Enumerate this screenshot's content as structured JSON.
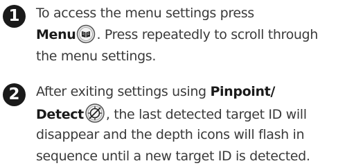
{
  "steps": [
    {
      "number": "1",
      "line1": "To access the menu settings press",
      "line2_bold": "Menu",
      "line2_rest": ". Press repeatedly to scroll through",
      "line3": "the menu settings.",
      "icon": "menu-book-icon"
    },
    {
      "number": "2",
      "line1_pre": "After exiting settings using ",
      "line1_bold": "Pinpoint/",
      "line2_bold": "Detect",
      "line2_rest": ", the last detected target ID will",
      "line3": "disappear and the depth icons will flash in",
      "line4": "sequence until a new target ID is detected.",
      "icon": "pinpoint-detect-icon"
    }
  ],
  "colors": {
    "text": "#3a3a3a",
    "bold": "#1a1a1a",
    "badge": "#1a1a1a"
  }
}
